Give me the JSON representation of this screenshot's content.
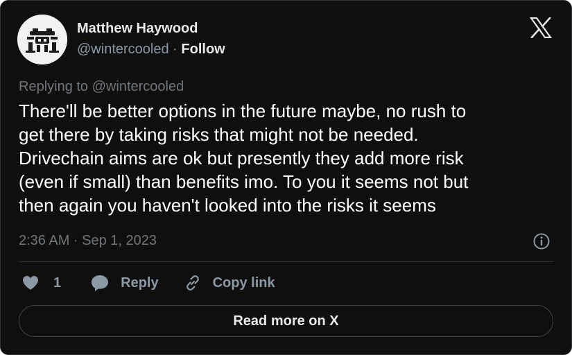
{
  "author": {
    "name": "Matthew Haywood",
    "handle": "@wintercooled",
    "separator": "·",
    "follow_label": "Follow"
  },
  "reply_context": {
    "prefix": "Replying to",
    "handle": "@wintercooled"
  },
  "tweet": {
    "lines": [
      "There'll be better options in the future maybe, no rush to",
      "get there by taking risks that might not be needed.",
      "Drivechain aims are ok but presently they add more risk",
      "(even if small) than benefits imo. To you it seems not but",
      "then again you haven't looked into the risks it seems"
    ],
    "timestamp": "2:36 AM · Sep 1, 2023"
  },
  "actions": {
    "like_count": "1",
    "reply_label": "Reply",
    "copy_label": "Copy link"
  },
  "read_more_label": "Read more on X",
  "icons": {
    "platform": "x-logo-icon",
    "info": "info-icon",
    "like": "heart-icon",
    "reply": "speech-bubble-icon",
    "copy": "link-icon"
  },
  "colors": {
    "background": "#0f0f0f",
    "text": "#e7e9ea",
    "muted": "#71767b",
    "border": "#2f3336"
  }
}
